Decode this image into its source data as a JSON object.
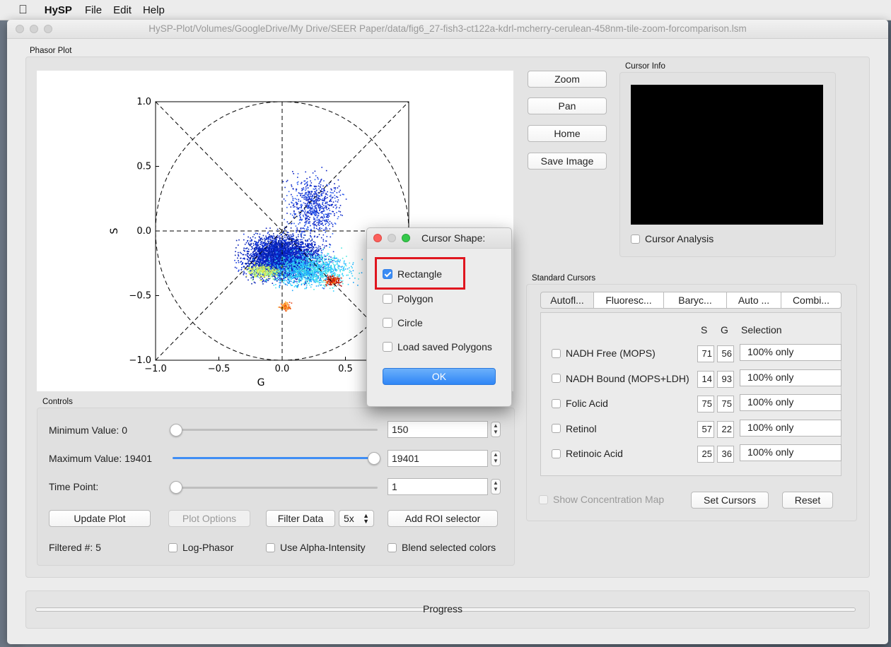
{
  "menubar": {
    "app_name": "HySP",
    "items": [
      "File",
      "Edit",
      "Help"
    ]
  },
  "window": {
    "title": "HySP-Plot/Volumes/GoogleDrive/My Drive/SEER Paper/data/fig6_27-fish3-ct122a-kdrl-mcherry-cerulean-458nm-tile-zoom-forcomparison.lsm"
  },
  "phasor_plot": {
    "group_label": "Phasor Plot",
    "chart_data": {
      "type": "scatter",
      "xlabel": "G",
      "ylabel": "S",
      "xlim": [
        -1.0,
        1.0
      ],
      "ylim": [
        -1.0,
        1.0
      ],
      "xticks": [
        "−1.0",
        "−0.5",
        "0.0",
        "0.5"
      ],
      "yticks": [
        "1.0",
        "0.5",
        "0.0",
        "−0.5",
        "−1.0"
      ],
      "grid": false,
      "overlays": [
        "unit circle (dashed)",
        "axes cross at 0 (dashed)",
        "diagonals (dashed)"
      ],
      "density_clusters": [
        {
          "g": 0.0,
          "s": -0.2,
          "spread_g": 0.28,
          "spread_s": 0.16,
          "level": "blue"
        },
        {
          "g": 0.22,
          "s": -0.3,
          "spread_g": 0.3,
          "spread_s": 0.12,
          "level": "cyan"
        },
        {
          "g": -0.15,
          "s": -0.31,
          "spread_g": 0.12,
          "spread_s": 0.05,
          "level": "yellow"
        },
        {
          "g": 0.4,
          "s": -0.38,
          "spread_g": 0.06,
          "spread_s": 0.04,
          "level": "red"
        },
        {
          "g": 0.02,
          "s": -0.58,
          "spread_g": 0.04,
          "spread_s": 0.03,
          "level": "orange"
        },
        {
          "g": 0.25,
          "s": 0.2,
          "spread_g": 0.2,
          "spread_s": 0.22,
          "level": "sparse-blue"
        }
      ]
    }
  },
  "plot_buttons": {
    "zoom": "Zoom",
    "pan": "Pan",
    "home": "Home",
    "save_image": "Save Image"
  },
  "cursor_info": {
    "group_label": "Cursor Info",
    "analysis_label": "Cursor Analysis"
  },
  "controls": {
    "group_label": "Controls",
    "minimum_label": "Minimum Value: 0",
    "minimum_value": "150",
    "minimum_slider_fraction": 0.0,
    "maximum_label": "Maximum Value: 19401",
    "maximum_value": "19401",
    "maximum_slider_fraction": 1.0,
    "time_label": "Time Point:",
    "time_value": "1",
    "time_slider_fraction": 0.0,
    "update_plot": "Update Plot",
    "plot_options": "Plot Options",
    "filter_data": "Filter Data",
    "filter_factor": "5x",
    "add_roi": "Add ROI selector",
    "filtered_count": "Filtered #: 5",
    "log_phasor": "Log-Phasor",
    "use_alpha": "Use Alpha-Intensity",
    "blend_colors": "Blend selected colors"
  },
  "standard_cursors": {
    "group_label": "Standard Cursors",
    "tabs": [
      "Autofl...",
      "Fluoresc...",
      "Baryc...",
      "Auto ...",
      "Combi..."
    ],
    "col_s": "S",
    "col_g": "G",
    "col_selection": "Selection",
    "rows": [
      {
        "name": "NADH Free (MOPS)",
        "s": "71",
        "g": "56",
        "selection": "100% only"
      },
      {
        "name": "NADH Bound (MOPS+LDH)",
        "s": "14",
        "g": "93",
        "selection": "100% only"
      },
      {
        "name": "Folic Acid",
        "s": "75",
        "g": "75",
        "selection": "100% only"
      },
      {
        "name": "Retinol",
        "s": "57",
        "g": "22",
        "selection": "100% only"
      },
      {
        "name": "Retinoic Acid",
        "s": "25",
        "g": "36",
        "selection": "100% only"
      }
    ],
    "show_concentration": "Show Concentration Map",
    "set_cursors": "Set Cursors",
    "reset": "Reset"
  },
  "progress": {
    "label": "Progress"
  },
  "dialog": {
    "title": "Cursor Shape:",
    "options": [
      {
        "label": "Rectangle",
        "checked": true
      },
      {
        "label": "Polygon",
        "checked": false
      },
      {
        "label": "Circle",
        "checked": false
      },
      {
        "label": "Load saved Polygons",
        "checked": false
      }
    ],
    "ok": "OK",
    "colors": {
      "close": "#fc605c",
      "minimize_disabled": "#d3d3d3",
      "zoom": "#34c84a",
      "highlight": "#e0161f",
      "ok_button": "#2f86f6"
    }
  }
}
